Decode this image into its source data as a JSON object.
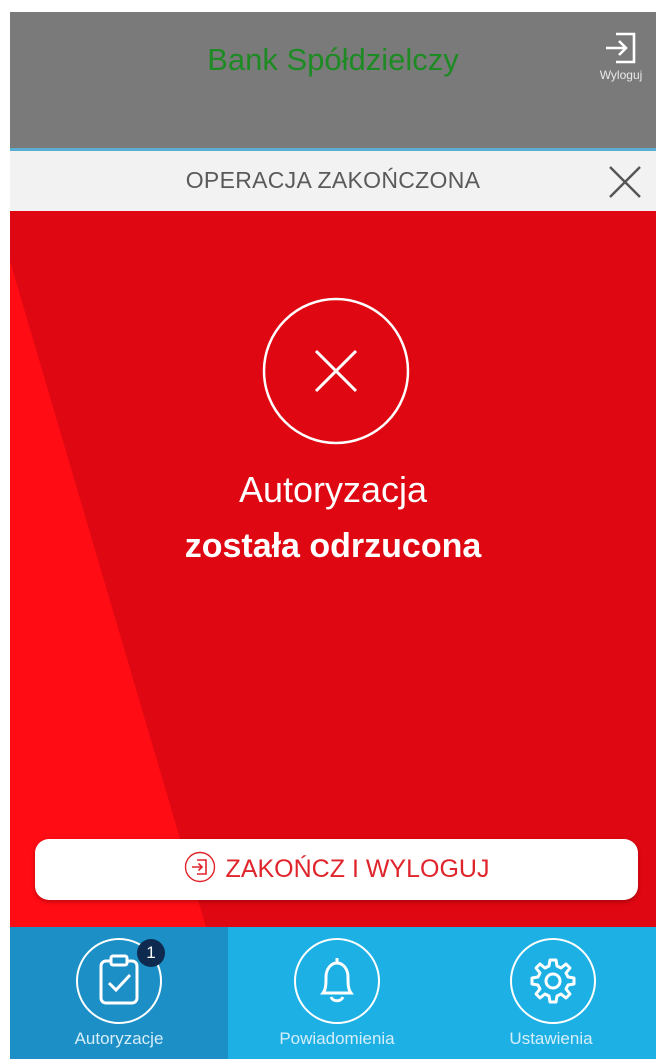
{
  "header": {
    "title": "Bank Spółdzielczy",
    "logout_label": "Wyloguj"
  },
  "operation": {
    "title": "OPERACJA ZAKOŃCZONA"
  },
  "result": {
    "line1": "Autoryzacja",
    "line2": "została odrzucona"
  },
  "end_button": {
    "label": "ZAKOŃCZ I WYLOGUJ"
  },
  "nav": {
    "items": [
      {
        "label": "Autoryzacje",
        "icon": "clipboard-check-icon",
        "badge": "1",
        "active": true
      },
      {
        "label": "Powiadomienia",
        "icon": "bell-icon"
      },
      {
        "label": "Ustawienia",
        "icon": "gear-icon"
      }
    ]
  },
  "colors": {
    "header_bg": "#7a7a7a",
    "title_green": "#1e8a23",
    "error_red": "#df0712",
    "nav_blue": "#1cb0e4",
    "nav_active": "#1b8fc6"
  }
}
